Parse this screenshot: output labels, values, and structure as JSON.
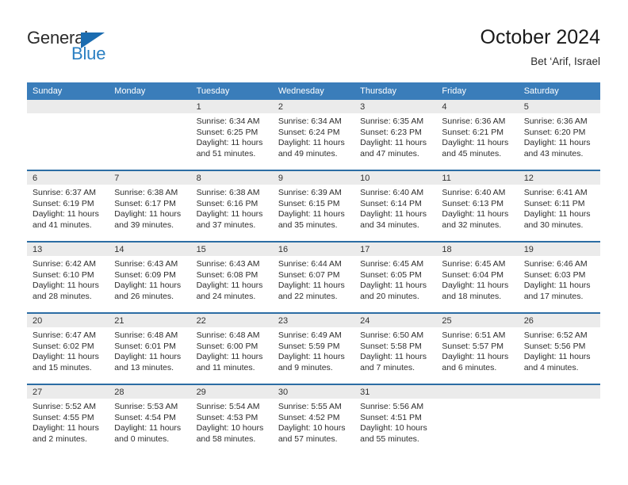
{
  "brand": {
    "name_part1": "General",
    "name_part2": "Blue",
    "triangle_color": "#1b6cb0",
    "blue_text_color": "#2a7fc2"
  },
  "header": {
    "title": "October 2024",
    "subtitle": "Bet ‘Arif, Israel"
  },
  "theme": {
    "header_row_bg": "#3a7dba",
    "header_row_text": "#ffffff",
    "row_separator": "#2c6da4",
    "daynum_band_bg": "#ebebeb",
    "page_bg": "#ffffff",
    "body_text": "#2d2d2d"
  },
  "calendar": {
    "month": "October",
    "year": "2024",
    "location": "Bet ‘Arif, Israel",
    "weekday_headers": [
      "Sunday",
      "Monday",
      "Tuesday",
      "Wednesday",
      "Thursday",
      "Friday",
      "Saturday"
    ],
    "weeks": [
      [
        {
          "day": "",
          "sunrise": "",
          "sunset": "",
          "daylight_line1": "",
          "daylight_line2": ""
        },
        {
          "day": "",
          "sunrise": "",
          "sunset": "",
          "daylight_line1": "",
          "daylight_line2": ""
        },
        {
          "day": "1",
          "sunrise": "Sunrise: 6:34 AM",
          "sunset": "Sunset: 6:25 PM",
          "daylight_line1": "Daylight: 11 hours",
          "daylight_line2": "and 51 minutes."
        },
        {
          "day": "2",
          "sunrise": "Sunrise: 6:34 AM",
          "sunset": "Sunset: 6:24 PM",
          "daylight_line1": "Daylight: 11 hours",
          "daylight_line2": "and 49 minutes."
        },
        {
          "day": "3",
          "sunrise": "Sunrise: 6:35 AM",
          "sunset": "Sunset: 6:23 PM",
          "daylight_line1": "Daylight: 11 hours",
          "daylight_line2": "and 47 minutes."
        },
        {
          "day": "4",
          "sunrise": "Sunrise: 6:36 AM",
          "sunset": "Sunset: 6:21 PM",
          "daylight_line1": "Daylight: 11 hours",
          "daylight_line2": "and 45 minutes."
        },
        {
          "day": "5",
          "sunrise": "Sunrise: 6:36 AM",
          "sunset": "Sunset: 6:20 PM",
          "daylight_line1": "Daylight: 11 hours",
          "daylight_line2": "and 43 minutes."
        }
      ],
      [
        {
          "day": "6",
          "sunrise": "Sunrise: 6:37 AM",
          "sunset": "Sunset: 6:19 PM",
          "daylight_line1": "Daylight: 11 hours",
          "daylight_line2": "and 41 minutes."
        },
        {
          "day": "7",
          "sunrise": "Sunrise: 6:38 AM",
          "sunset": "Sunset: 6:17 PM",
          "daylight_line1": "Daylight: 11 hours",
          "daylight_line2": "and 39 minutes."
        },
        {
          "day": "8",
          "sunrise": "Sunrise: 6:38 AM",
          "sunset": "Sunset: 6:16 PM",
          "daylight_line1": "Daylight: 11 hours",
          "daylight_line2": "and 37 minutes."
        },
        {
          "day": "9",
          "sunrise": "Sunrise: 6:39 AM",
          "sunset": "Sunset: 6:15 PM",
          "daylight_line1": "Daylight: 11 hours",
          "daylight_line2": "and 35 minutes."
        },
        {
          "day": "10",
          "sunrise": "Sunrise: 6:40 AM",
          "sunset": "Sunset: 6:14 PM",
          "daylight_line1": "Daylight: 11 hours",
          "daylight_line2": "and 34 minutes."
        },
        {
          "day": "11",
          "sunrise": "Sunrise: 6:40 AM",
          "sunset": "Sunset: 6:13 PM",
          "daylight_line1": "Daylight: 11 hours",
          "daylight_line2": "and 32 minutes."
        },
        {
          "day": "12",
          "sunrise": "Sunrise: 6:41 AM",
          "sunset": "Sunset: 6:11 PM",
          "daylight_line1": "Daylight: 11 hours",
          "daylight_line2": "and 30 minutes."
        }
      ],
      [
        {
          "day": "13",
          "sunrise": "Sunrise: 6:42 AM",
          "sunset": "Sunset: 6:10 PM",
          "daylight_line1": "Daylight: 11 hours",
          "daylight_line2": "and 28 minutes."
        },
        {
          "day": "14",
          "sunrise": "Sunrise: 6:43 AM",
          "sunset": "Sunset: 6:09 PM",
          "daylight_line1": "Daylight: 11 hours",
          "daylight_line2": "and 26 minutes."
        },
        {
          "day": "15",
          "sunrise": "Sunrise: 6:43 AM",
          "sunset": "Sunset: 6:08 PM",
          "daylight_line1": "Daylight: 11 hours",
          "daylight_line2": "and 24 minutes."
        },
        {
          "day": "16",
          "sunrise": "Sunrise: 6:44 AM",
          "sunset": "Sunset: 6:07 PM",
          "daylight_line1": "Daylight: 11 hours",
          "daylight_line2": "and 22 minutes."
        },
        {
          "day": "17",
          "sunrise": "Sunrise: 6:45 AM",
          "sunset": "Sunset: 6:05 PM",
          "daylight_line1": "Daylight: 11 hours",
          "daylight_line2": "and 20 minutes."
        },
        {
          "day": "18",
          "sunrise": "Sunrise: 6:45 AM",
          "sunset": "Sunset: 6:04 PM",
          "daylight_line1": "Daylight: 11 hours",
          "daylight_line2": "and 18 minutes."
        },
        {
          "day": "19",
          "sunrise": "Sunrise: 6:46 AM",
          "sunset": "Sunset: 6:03 PM",
          "daylight_line1": "Daylight: 11 hours",
          "daylight_line2": "and 17 minutes."
        }
      ],
      [
        {
          "day": "20",
          "sunrise": "Sunrise: 6:47 AM",
          "sunset": "Sunset: 6:02 PM",
          "daylight_line1": "Daylight: 11 hours",
          "daylight_line2": "and 15 minutes."
        },
        {
          "day": "21",
          "sunrise": "Sunrise: 6:48 AM",
          "sunset": "Sunset: 6:01 PM",
          "daylight_line1": "Daylight: 11 hours",
          "daylight_line2": "and 13 minutes."
        },
        {
          "day": "22",
          "sunrise": "Sunrise: 6:48 AM",
          "sunset": "Sunset: 6:00 PM",
          "daylight_line1": "Daylight: 11 hours",
          "daylight_line2": "and 11 minutes."
        },
        {
          "day": "23",
          "sunrise": "Sunrise: 6:49 AM",
          "sunset": "Sunset: 5:59 PM",
          "daylight_line1": "Daylight: 11 hours",
          "daylight_line2": "and 9 minutes."
        },
        {
          "day": "24",
          "sunrise": "Sunrise: 6:50 AM",
          "sunset": "Sunset: 5:58 PM",
          "daylight_line1": "Daylight: 11 hours",
          "daylight_line2": "and 7 minutes."
        },
        {
          "day": "25",
          "sunrise": "Sunrise: 6:51 AM",
          "sunset": "Sunset: 5:57 PM",
          "daylight_line1": "Daylight: 11 hours",
          "daylight_line2": "and 6 minutes."
        },
        {
          "day": "26",
          "sunrise": "Sunrise: 6:52 AM",
          "sunset": "Sunset: 5:56 PM",
          "daylight_line1": "Daylight: 11 hours",
          "daylight_line2": "and 4 minutes."
        }
      ],
      [
        {
          "day": "27",
          "sunrise": "Sunrise: 5:52 AM",
          "sunset": "Sunset: 4:55 PM",
          "daylight_line1": "Daylight: 11 hours",
          "daylight_line2": "and 2 minutes."
        },
        {
          "day": "28",
          "sunrise": "Sunrise: 5:53 AM",
          "sunset": "Sunset: 4:54 PM",
          "daylight_line1": "Daylight: 11 hours",
          "daylight_line2": "and 0 minutes."
        },
        {
          "day": "29",
          "sunrise": "Sunrise: 5:54 AM",
          "sunset": "Sunset: 4:53 PM",
          "daylight_line1": "Daylight: 10 hours",
          "daylight_line2": "and 58 minutes."
        },
        {
          "day": "30",
          "sunrise": "Sunrise: 5:55 AM",
          "sunset": "Sunset: 4:52 PM",
          "daylight_line1": "Daylight: 10 hours",
          "daylight_line2": "and 57 minutes."
        },
        {
          "day": "31",
          "sunrise": "Sunrise: 5:56 AM",
          "sunset": "Sunset: 4:51 PM",
          "daylight_line1": "Daylight: 10 hours",
          "daylight_line2": "and 55 minutes."
        },
        {
          "day": "",
          "sunrise": "",
          "sunset": "",
          "daylight_line1": "",
          "daylight_line2": ""
        },
        {
          "day": "",
          "sunrise": "",
          "sunset": "",
          "daylight_line1": "",
          "daylight_line2": ""
        }
      ]
    ]
  }
}
